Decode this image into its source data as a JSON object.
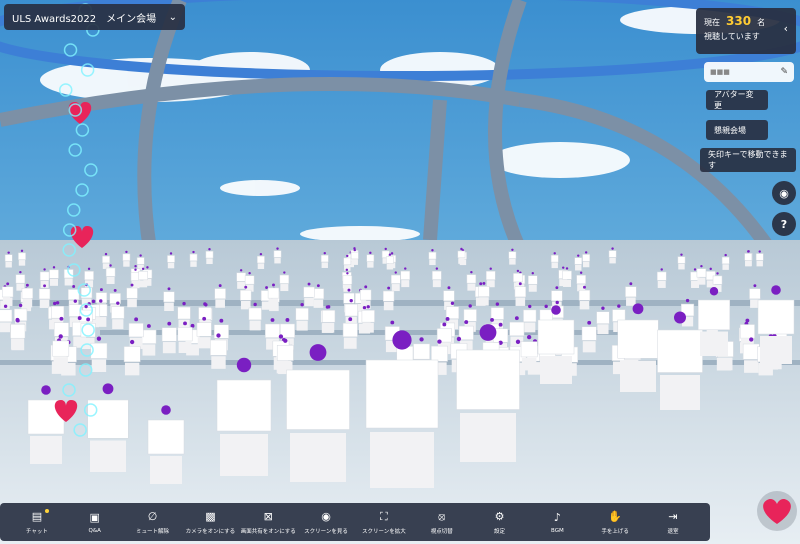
{
  "venue": {
    "label": "ULS Awards2022　メイン会場"
  },
  "viewers": {
    "prefix": "現在",
    "count": "330",
    "suffix": "名",
    "line2": "視聴しています"
  },
  "sidebar": {
    "name_chip": "■■■",
    "avatar_button": "アバター変更",
    "lounge_button": "懇親会場",
    "hint": "矢印キーで移動できます"
  },
  "toolbar": {
    "items": [
      {
        "label": "チャット",
        "icon": "chat-icon"
      },
      {
        "label": "Q&A",
        "icon": "qa-icon"
      },
      {
        "label": "ミュート解除",
        "icon": "mic-off-icon"
      },
      {
        "label": "カメラをオンにする",
        "icon": "camera-off-icon"
      },
      {
        "label": "画面共有をオンにする",
        "icon": "screen-share-icon"
      },
      {
        "label": "スクリーンを見る",
        "icon": "eye-icon"
      },
      {
        "label": "スクリーンを拡大",
        "icon": "expand-icon"
      },
      {
        "label": "視点切替",
        "icon": "view-switch-icon"
      },
      {
        "label": "設定",
        "icon": "gear-icon"
      },
      {
        "label": "BGM",
        "icon": "music-icon"
      },
      {
        "label": "手を上げる",
        "icon": "hand-icon"
      },
      {
        "label": "退室",
        "icon": "exit-icon"
      }
    ]
  },
  "colors": {
    "panel": "#2d3546",
    "accent": "#ffcc33",
    "heart": "#e8245a",
    "avatar_purple": "#7a1fc2"
  }
}
